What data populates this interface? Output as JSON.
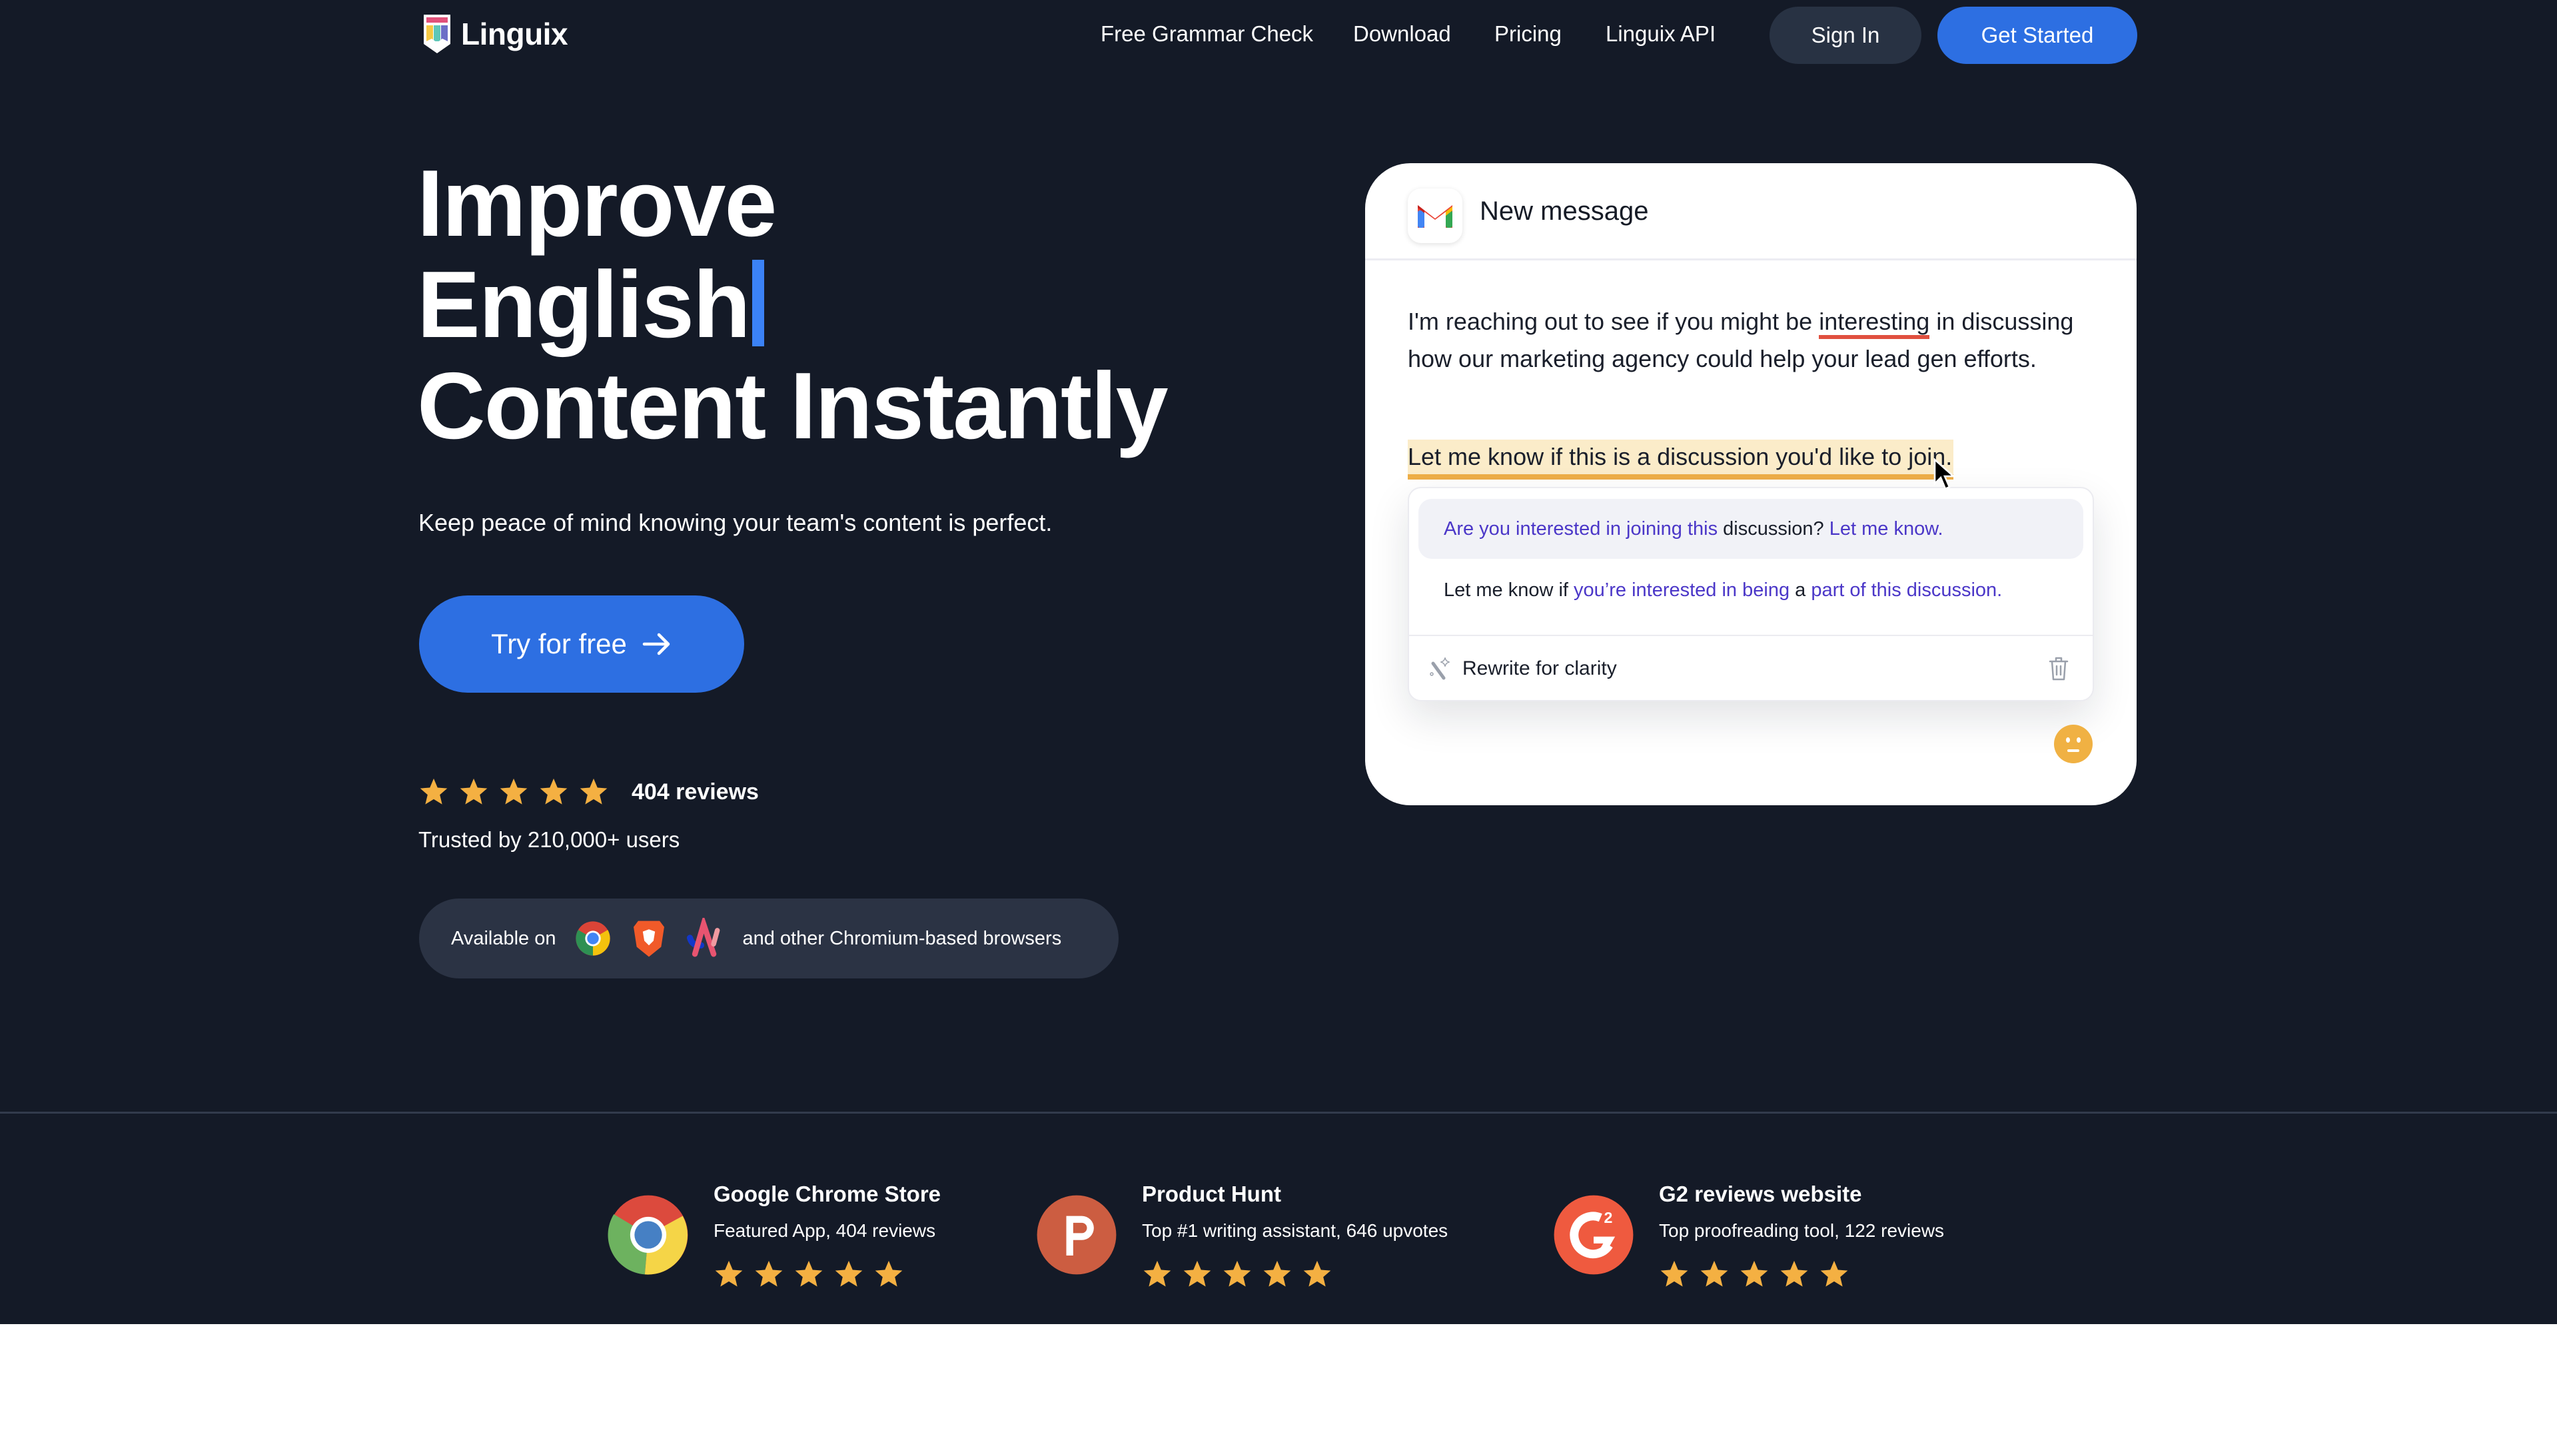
{
  "nav": {
    "brand": "Linguix",
    "links": [
      "Free Grammar Check",
      "Download",
      "Pricing",
      "Linguix API"
    ],
    "sign_in": "Sign In",
    "get_started": "Get Started"
  },
  "hero": {
    "headline_line1": "Improve",
    "headline_line2": "English",
    "headline_line3": "Content Instantly",
    "subtitle": "Keep peace of mind knowing your team's content is perfect.",
    "cta_label": "Try for free",
    "rating_stars": 5,
    "reviews_count": "404 reviews",
    "trusted": "Trusted by 210,000+ users",
    "available_label": "Available on",
    "available_browsers": [
      "chrome-icon",
      "brave-icon",
      "arc-icon"
    ],
    "available_suffix": "and other Chromium-based browsers"
  },
  "card": {
    "title": "New message",
    "para_before": "I'm reaching out to see if you might be ",
    "para_error": "interesting",
    "para_after": " in discussing how our marketing agency could help your lead gen efforts.",
    "highlighted": "Let me know if this is a discussion you'd like to join.",
    "suggestion1": {
      "a": "Are you interested in joining this",
      "b": " discussion? ",
      "c": "Let me know."
    },
    "suggestion2": {
      "a": "Let me know if ",
      "b": "you’re interested in being",
      "c": " a ",
      "d": "part of this discussion."
    },
    "rewrite_label": "Rewrite for clarity"
  },
  "reviews": [
    {
      "title": "Google Chrome Store",
      "subtitle": "Featured App, 404 reviews",
      "stars": 5,
      "icon": "chrome-icon"
    },
    {
      "title": "Product Hunt",
      "subtitle": "Top #1 writing assistant, 646 upvotes",
      "stars": 5,
      "icon": "product-hunt-icon"
    },
    {
      "title": "G2 reviews website",
      "subtitle": "Top proofreading tool, 122 reviews",
      "stars": 5,
      "icon": "g2-icon"
    }
  ],
  "colors": {
    "background": "#141a27",
    "accent_blue": "#2d6fe2",
    "star": "#f4b042",
    "error_underline": "#e0503f",
    "highlight": "#fbecc9",
    "suggestion_text": "#4b37c8"
  }
}
